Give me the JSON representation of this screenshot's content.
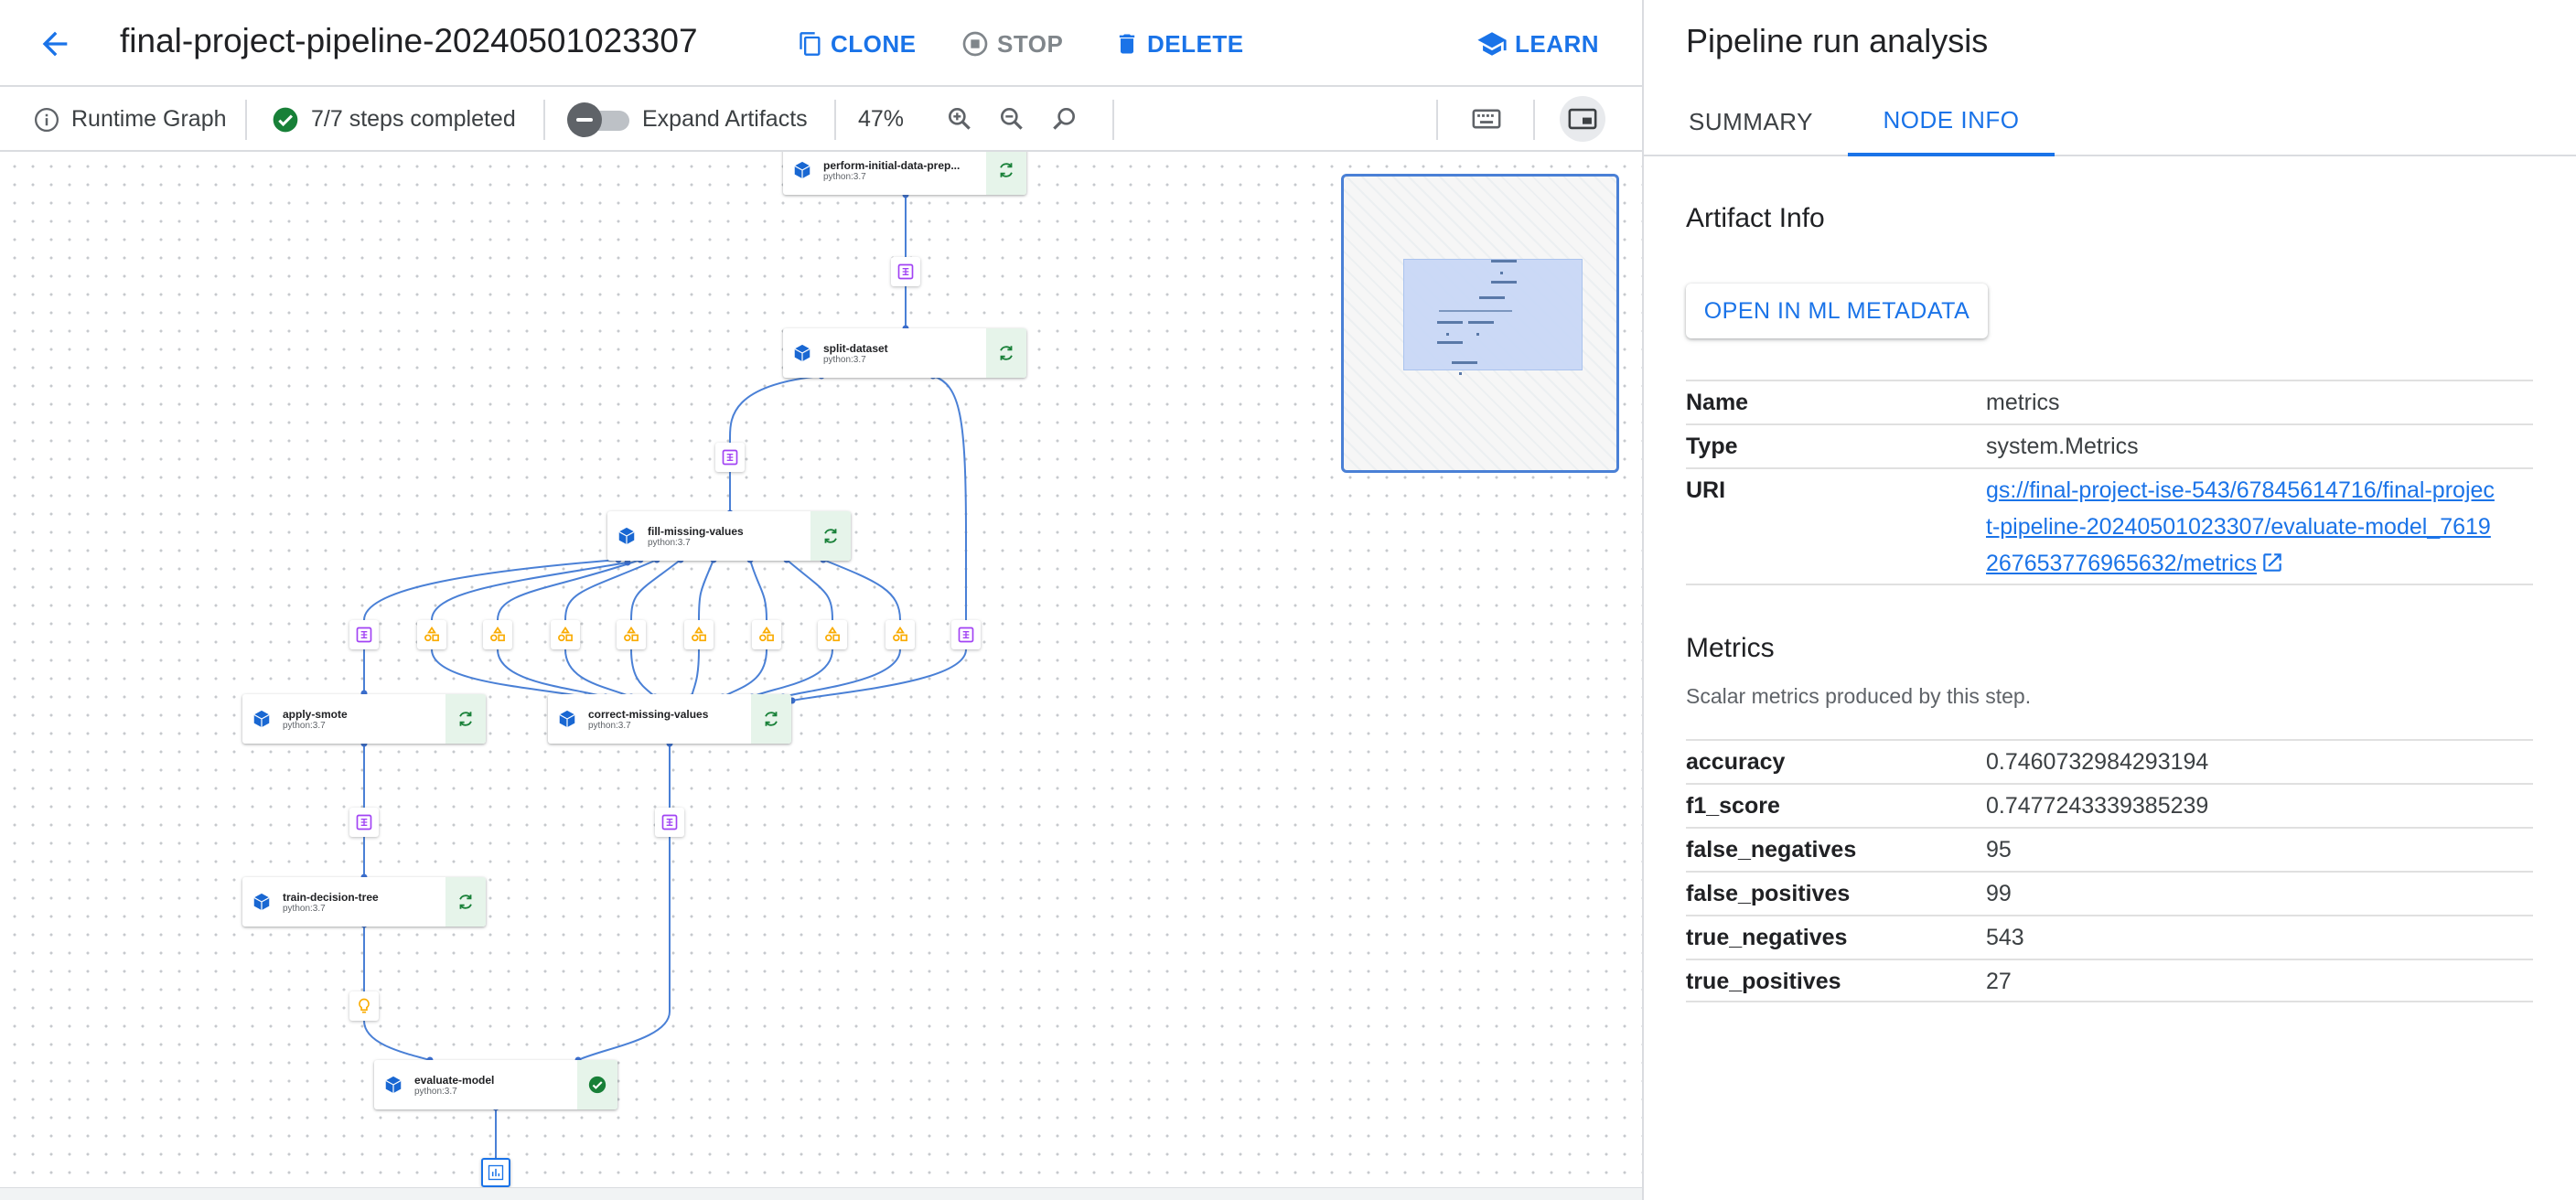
{
  "header": {
    "title": "final-project-pipeline-20240501023307",
    "clone_label": "CLONE",
    "stop_label": "STOP",
    "delete_label": "DELETE",
    "learn_label": "LEARN"
  },
  "toolbar": {
    "runtime_graph_label": "Runtime Graph",
    "steps_completed": "7/7 steps completed",
    "expand_artifacts_label": "Expand Artifacts",
    "zoom_level": "47%"
  },
  "graph": {
    "nodes": [
      {
        "name": "perform-initial-data-prep...",
        "version": "python:3.7",
        "status": "cached"
      },
      {
        "name": "split-dataset",
        "version": "python:3.7",
        "status": "cached"
      },
      {
        "name": "fill-missing-values",
        "version": "python:3.7",
        "status": "cached"
      },
      {
        "name": "apply-smote",
        "version": "python:3.7",
        "status": "cached"
      },
      {
        "name": "correct-missing-values",
        "version": "python:3.7",
        "status": "cached"
      },
      {
        "name": "train-decision-tree",
        "version": "python:3.7",
        "status": "cached"
      },
      {
        "name": "evaluate-model",
        "version": "python:3.7",
        "status": "succeeded"
      }
    ]
  },
  "panel": {
    "title": "Pipeline run analysis",
    "tabs": [
      {
        "label": "SUMMARY"
      },
      {
        "label": "NODE INFO"
      }
    ],
    "active_tab": "NODE INFO",
    "artifact_info_title": "Artifact Info",
    "open_ml_metadata_label": "OPEN IN ML METADATA",
    "artifact": [
      {
        "key": "Name",
        "value": "metrics"
      },
      {
        "key": "Type",
        "value": "system.Metrics"
      },
      {
        "key": "URI",
        "value": "gs://final-project-ise-543/67845614716/final-project-pipeline-20240501023307/evaluate-model_7619267653776965632/metrics"
      }
    ],
    "metrics_title": "Metrics",
    "metrics_subtitle": "Scalar metrics produced by this step.",
    "metrics": [
      {
        "key": "accuracy",
        "value": "0.7460732984293194"
      },
      {
        "key": "f1_score",
        "value": "0.7477243339385239"
      },
      {
        "key": "false_negatives",
        "value": "95"
      },
      {
        "key": "false_positives",
        "value": "99"
      },
      {
        "key": "true_negatives",
        "value": "543"
      },
      {
        "key": "true_positives",
        "value": "27"
      }
    ]
  },
  "colors": {
    "accent": "#1a73e8",
    "edge": "#4a80d6",
    "dataset_artifact": "#a142f4",
    "model_artifact": "#f9ab00",
    "node_status_bg": "#e6f4ea",
    "status_green": "#188038",
    "node_icon": "#1967d2"
  }
}
